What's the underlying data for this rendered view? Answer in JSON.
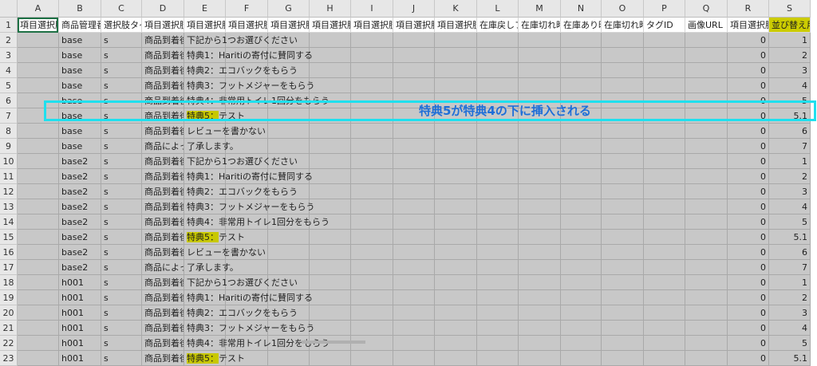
{
  "columns": [
    "A",
    "B",
    "C",
    "D",
    "E",
    "F",
    "G",
    "H",
    "I",
    "J",
    "K",
    "L",
    "M",
    "N",
    "O",
    "P",
    "Q",
    "R",
    "S"
  ],
  "header_row": [
    "項目選択肢",
    "商品管理番",
    "選択肢タイ",
    "項目選択肢",
    "項目選択肢",
    "項目選択肢",
    "項目選択肢",
    "項目選択肢",
    "項目選択肢",
    "項目選択肢",
    "項目選択肢",
    "在庫戻しフ",
    "在庫切れ時",
    "在庫あり時",
    "在庫切れ時",
    "タグID",
    "画像URL",
    "項目選択肢",
    "並び替え用"
  ],
  "rows": [
    {
      "num": "2",
      "b": "base",
      "c": "s",
      "d": "商品到着後",
      "e": "下記から1つお選びください",
      "r": "0",
      "s": "1",
      "hl": false
    },
    {
      "num": "3",
      "b": "base",
      "c": "s",
      "d": "商品到着後",
      "e": "特典1：Haritiの寄付に賛同する",
      "r": "0",
      "s": "2",
      "hl": false
    },
    {
      "num": "4",
      "b": "base",
      "c": "s",
      "d": "商品到着後",
      "e": "特典2：エコバックをもらう",
      "r": "0",
      "s": "3",
      "hl": false
    },
    {
      "num": "5",
      "b": "base",
      "c": "s",
      "d": "商品到着後",
      "e": "特典3：フットメジャーをもらう",
      "r": "0",
      "s": "4",
      "hl": false
    },
    {
      "num": "6",
      "b": "base",
      "c": "s",
      "d": "商品到着後",
      "e": "特典4：非常用トイレ1回分をもらう",
      "r": "0",
      "s": "5",
      "hl": false
    },
    {
      "num": "7",
      "b": "base",
      "c": "s",
      "d": "商品到着後",
      "e": "特典5：テスト",
      "r": "0",
      "s": "5.1",
      "hl": true
    },
    {
      "num": "8",
      "b": "base",
      "c": "s",
      "d": "商品到着後",
      "e": "レビューを書かない",
      "r": "0",
      "s": "6",
      "hl": false
    },
    {
      "num": "9",
      "b": "base",
      "c": "s",
      "d": "商品によっ",
      "e": "了承します。",
      "r": "0",
      "s": "7",
      "hl": false
    },
    {
      "num": "10",
      "b": "base2",
      "c": "s",
      "d": "商品到着後",
      "e": "下記から1つお選びください",
      "r": "0",
      "s": "1",
      "hl": false
    },
    {
      "num": "11",
      "b": "base2",
      "c": "s",
      "d": "商品到着後",
      "e": "特典1：Haritiの寄付に賛同する",
      "r": "0",
      "s": "2",
      "hl": false
    },
    {
      "num": "12",
      "b": "base2",
      "c": "s",
      "d": "商品到着後",
      "e": "特典2：エコバックをもらう",
      "r": "0",
      "s": "3",
      "hl": false
    },
    {
      "num": "13",
      "b": "base2",
      "c": "s",
      "d": "商品到着後",
      "e": "特典3：フットメジャーをもらう",
      "r": "0",
      "s": "4",
      "hl": false
    },
    {
      "num": "14",
      "b": "base2",
      "c": "s",
      "d": "商品到着後",
      "e": "特典4：非常用トイレ1回分をもらう",
      "r": "0",
      "s": "5",
      "hl": false
    },
    {
      "num": "15",
      "b": "base2",
      "c": "s",
      "d": "商品到着後",
      "e": "特典5：テスト",
      "r": "0",
      "s": "5.1",
      "hl": true
    },
    {
      "num": "16",
      "b": "base2",
      "c": "s",
      "d": "商品到着後",
      "e": "レビューを書かない",
      "r": "0",
      "s": "6",
      "hl": false
    },
    {
      "num": "17",
      "b": "base2",
      "c": "s",
      "d": "商品によっ",
      "e": "了承します。",
      "r": "0",
      "s": "7",
      "hl": false
    },
    {
      "num": "18",
      "b": "h001",
      "c": "s",
      "d": "商品到着後",
      "e": "下記から1つお選びください",
      "r": "0",
      "s": "1",
      "hl": false
    },
    {
      "num": "19",
      "b": "h001",
      "c": "s",
      "d": "商品到着後",
      "e": "特典1：Haritiの寄付に賛同する",
      "r": "0",
      "s": "2",
      "hl": false
    },
    {
      "num": "20",
      "b": "h001",
      "c": "s",
      "d": "商品到着後",
      "e": "特典2：エコバックをもらう",
      "r": "0",
      "s": "3",
      "hl": false
    },
    {
      "num": "21",
      "b": "h001",
      "c": "s",
      "d": "商品到着後",
      "e": "特典3：フットメジャーをもらう",
      "r": "0",
      "s": "4",
      "hl": false
    },
    {
      "num": "22",
      "b": "h001",
      "c": "s",
      "d": "商品到着後",
      "e": "特典4：非常用トイレ1回分をもらう",
      "r": "0",
      "s": "5",
      "hl": false
    },
    {
      "num": "23",
      "b": "h001",
      "c": "s",
      "d": "商品到着後",
      "e": "特典5：テスト",
      "r": "0",
      "s": "5.1",
      "hl": true
    }
  ],
  "header_row_num": "1",
  "callout_text": "特典5が特典4の下に挿入される",
  "colors": {
    "highlight": "#c8c800",
    "callout_border": "#1fe0ee",
    "callout_text": "#1e6ed8",
    "cell_bg": "#c8c8c8"
  }
}
